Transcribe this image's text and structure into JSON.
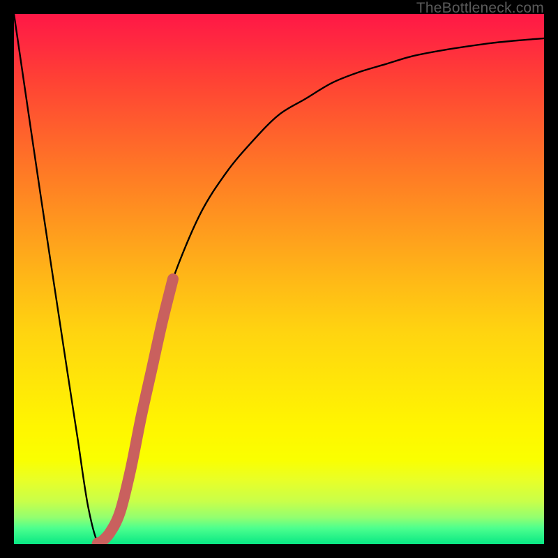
{
  "watermark": "TheBottleneck.com",
  "colors": {
    "frame": "#000000",
    "curve": "#000000",
    "accent_marker": "#c9605e",
    "gradient_top": "#ff1846",
    "gradient_bottom": "#08e884"
  },
  "chart_data": {
    "type": "line",
    "title": "",
    "xlabel": "",
    "ylabel": "",
    "xlim": [
      0,
      100
    ],
    "ylim": [
      0,
      100
    ],
    "grid": false,
    "legend": false,
    "series": [
      {
        "name": "bottleneck-curve",
        "x": [
          0,
          5,
          10,
          12,
          14,
          16,
          18,
          20,
          22,
          24,
          26,
          28,
          30,
          35,
          40,
          45,
          50,
          55,
          60,
          65,
          70,
          75,
          80,
          85,
          90,
          95,
          100
        ],
        "y": [
          100,
          66,
          33,
          20,
          7,
          0,
          2,
          6,
          14,
          24,
          33,
          42,
          50,
          62,
          70,
          76,
          81,
          84,
          87,
          89,
          90.5,
          92,
          93,
          93.8,
          94.5,
          95,
          95.4
        ]
      }
    ],
    "accent_segment": {
      "name": "highlight-region",
      "x": [
        16,
        18,
        20,
        22,
        24,
        26,
        28,
        30
      ],
      "y": [
        0,
        2,
        6,
        14,
        24,
        33,
        42,
        50
      ]
    }
  }
}
